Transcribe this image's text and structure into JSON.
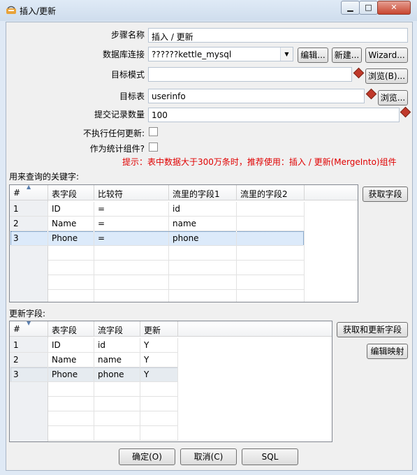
{
  "window": {
    "title": "插入/更新",
    "minimize_label": "▁",
    "maximize_label": "□",
    "close_label": "✕"
  },
  "form": {
    "step_name_label": "步骤名称",
    "step_name_value": "插入 / 更新",
    "db_conn_label": "数据库连接",
    "db_conn_value": "??????kettle_mysql",
    "edit_btn": "编辑...",
    "new_btn": "新建...",
    "wizard_btn": "Wizard...",
    "target_schema_label": "目标模式",
    "target_schema_value": "",
    "browse_b_btn": "浏览(B)...",
    "target_table_label": "目标表",
    "target_table_value": "userinfo",
    "browse_btn": "浏览...",
    "commit_size_label": "提交记录数量",
    "commit_size_value": "100",
    "no_update_label": "不执行任何更新:",
    "stats_label": "作为统计组件?",
    "hint": "提示：表中数据大于300万条时，推荐使用：插入 / 更新(MergeInto)组件"
  },
  "keys_section": {
    "label": "用来查询的关键字:",
    "get_fields_btn": "获取字段",
    "columns": [
      "#",
      "表字段",
      "比较符",
      "流里的字段1",
      "流里的字段2"
    ],
    "rows": [
      {
        "num": "1",
        "field": "ID",
        "cmp": "=",
        "stream1": "id",
        "stream2": ""
      },
      {
        "num": "2",
        "field": "Name",
        "cmp": "=",
        "stream1": "name",
        "stream2": ""
      },
      {
        "num": "3",
        "field": "Phone",
        "cmp": "=",
        "stream1": "phone",
        "stream2": ""
      }
    ]
  },
  "update_section": {
    "label": "更新字段:",
    "get_update_btn": "获取和更新字段",
    "edit_mapping_btn": "编辑映射",
    "columns": [
      "#",
      "表字段",
      "流字段",
      "更新"
    ],
    "rows": [
      {
        "num": "1",
        "field": "ID",
        "stream": "id",
        "update": "Y"
      },
      {
        "num": "2",
        "field": "Name",
        "stream": "name",
        "update": "Y"
      },
      {
        "num": "3",
        "field": "Phone",
        "stream": "phone",
        "update": "Y"
      }
    ]
  },
  "footer": {
    "ok_btn": "确定(O)",
    "cancel_btn": "取消(C)",
    "sql_btn": "SQL"
  }
}
